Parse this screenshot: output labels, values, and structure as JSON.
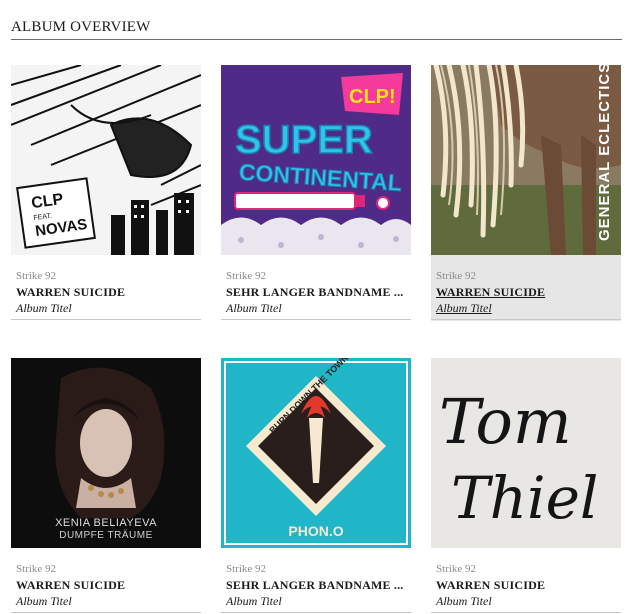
{
  "page": {
    "title": "ALBUM OVERVIEW"
  },
  "albums": [
    {
      "label": "Strike 92",
      "artist": "WARREN SUICIDE",
      "title": "Album Titel",
      "cover_text": [
        "CLP",
        "FEAT.",
        "NOVAS"
      ]
    },
    {
      "label": "Strike 92",
      "artist": "SEHR LANGER BANDNAME ...",
      "title": "Album Titel",
      "cover_text": [
        "CLP!",
        "SUPER",
        "CONTINENTAL"
      ]
    },
    {
      "label": "Strike 92",
      "artist": "WARREN SUICIDE",
      "title": "Album Titel",
      "cover_text": [
        "GENERAL ECLECTICS"
      ],
      "highlighted": true
    },
    {
      "label": "Strike 92",
      "artist": "WARREN SUICIDE",
      "title": "Album Titel",
      "cover_text": [
        "XENIA BELIAYEVA",
        "DUMPFE TRÄUME"
      ]
    },
    {
      "label": "Strike 92",
      "artist": "SEHR LANGER BANDNAME ...",
      "title": "Album Titel",
      "cover_text": [
        "BURN DOWN THE TOWN",
        "PHON.O"
      ]
    },
    {
      "label": "Strike 92",
      "artist": "WARREN SUICIDE",
      "title": "Album Titel",
      "cover_text": [
        "Tom",
        "Thiel"
      ]
    }
  ],
  "colors": {
    "accent_purple": "#4f2a86",
    "accent_cyan": "#20b6c7",
    "hover_bg": "#e6e6e6",
    "separator": "#c8c8c8"
  }
}
